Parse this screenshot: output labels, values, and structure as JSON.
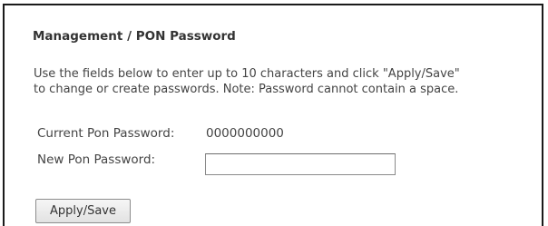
{
  "page": {
    "title": "Management / PON Password",
    "description_lines": [
      "Use the fields below to enter up to 10 characters and click \"Apply/Save\"",
      "to change or create passwords. Note: Password cannot contain a space."
    ]
  },
  "form": {
    "current_label": "Current Pon Password:",
    "current_value": "0000000000",
    "new_label": "New Pon Password:",
    "new_value": "",
    "new_placeholder": ""
  },
  "actions": {
    "apply_label": "Apply/Save"
  }
}
